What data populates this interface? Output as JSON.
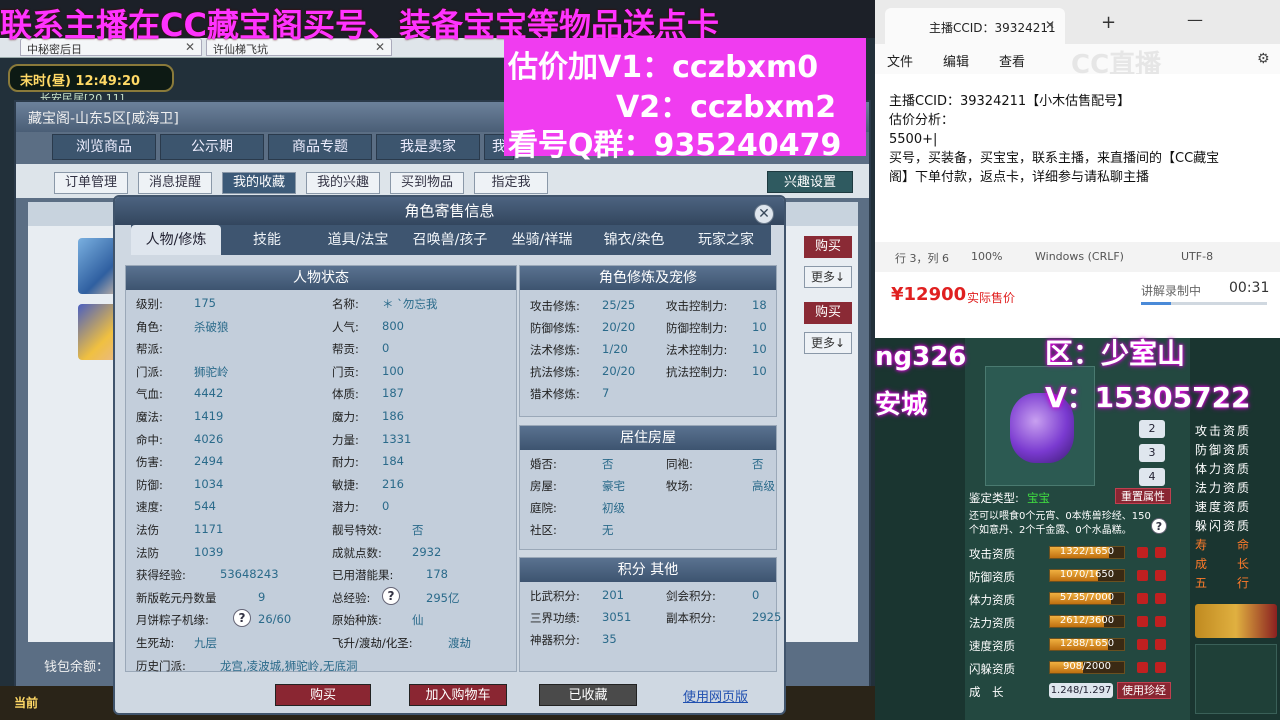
{
  "banner": {
    "top_text": "联系主播在CC藏宝阁买号、装备宝宝等物品送点卡",
    "price_line1": "估价加V1：cczbxm0",
    "price_line2": "V2：cczbxm2",
    "price_line3": "看号Q群：935240479"
  },
  "game": {
    "browser_tabs": [
      "中秘密后日",
      "许仙梯飞坑"
    ],
    "time": "末时(昼)  12:49:20",
    "location": "长安民居[20,11]",
    "window_title": "藏宝阁-山东5区[威海卫]",
    "main_tabs": [
      "浏览商品",
      "公示期",
      "商品专题",
      "我是卖家",
      "我"
    ],
    "sub_tabs": [
      "订单管理",
      "消息提醒",
      "我的收藏",
      "我的兴趣",
      "买到物品",
      "指定我"
    ],
    "interest_settings": "兴趣设置",
    "side_buy": "购买",
    "side_more": "更多↓",
    "wallet": "钱包余额：",
    "bottom_now": "当前"
  },
  "modal": {
    "title": "角色寄售信息",
    "tabs": [
      "人物/修炼",
      "技能",
      "道具/法宝",
      "召唤兽/孩子",
      "坐骑/祥瑞",
      "锦衣/染色",
      "玩家之家"
    ],
    "status_title": "人物状态",
    "left_col": [
      {
        "k": "级别:",
        "v": "175"
      },
      {
        "k": "角色:",
        "v": "杀破狼"
      },
      {
        "k": "帮派:",
        "v": ""
      },
      {
        "k": "门派:",
        "v": "狮驼岭"
      },
      {
        "k": "气血:",
        "v": "4442"
      },
      {
        "k": "魔法:",
        "v": "1419"
      },
      {
        "k": "命中:",
        "v": "4026"
      },
      {
        "k": "伤害:",
        "v": "2494"
      },
      {
        "k": "防御:",
        "v": "1034"
      },
      {
        "k": "速度:",
        "v": "544"
      },
      {
        "k": "法伤",
        "v": "1171"
      },
      {
        "k": "法防",
        "v": "1039"
      },
      {
        "k": "获得经验:",
        "v": "53648243"
      },
      {
        "k": "新版乾元丹数量",
        "v": "9"
      },
      {
        "k": "月饼粽子机缘:",
        "v": "26/60"
      },
      {
        "k": "生死劫:",
        "v": "九层"
      },
      {
        "k": "历史门派:",
        "v": "龙宫,凌波城,狮驼岭,无底洞"
      }
    ],
    "mid_col": [
      {
        "k": "名称:",
        "v": "＊ `勿忘我"
      },
      {
        "k": "人气:",
        "v": "800"
      },
      {
        "k": "帮贡:",
        "v": "0"
      },
      {
        "k": "门贡:",
        "v": "100"
      },
      {
        "k": "体质:",
        "v": "187"
      },
      {
        "k": "魔力:",
        "v": "186"
      },
      {
        "k": "力量:",
        "v": "1331"
      },
      {
        "k": "耐力:",
        "v": "184"
      },
      {
        "k": "敏捷:",
        "v": "216"
      },
      {
        "k": "潜力:",
        "v": "0"
      },
      {
        "k": "靓号特效:",
        "v": "否"
      },
      {
        "k": "成就点数:",
        "v": "2932"
      },
      {
        "k": "已用潜能果:",
        "v": "178"
      },
      {
        "k": "总经验:",
        "v": "295亿"
      },
      {
        "k": "原始种族:",
        "v": "仙"
      },
      {
        "k": "飞升/渡劫/化圣:",
        "v": "渡劫"
      }
    ],
    "train_title": "角色修炼及宠修",
    "train": [
      {
        "k": "攻击修炼:",
        "v": "25/25",
        "k2": "攻击控制力:",
        "v2": "18"
      },
      {
        "k": "防御修炼:",
        "v": "20/20",
        "k2": "防御控制力:",
        "v2": "10"
      },
      {
        "k": "法术修炼:",
        "v": "1/20",
        "k2": "法术控制力:",
        "v2": "10"
      },
      {
        "k": "抗法修炼:",
        "v": "20/20",
        "k2": "抗法控制力:",
        "v2": "10"
      },
      {
        "k": "猎术修炼:",
        "v": "7",
        "k2": "",
        "v2": ""
      }
    ],
    "house_title": "居住房屋",
    "house": [
      {
        "k": "婚否:",
        "v": "否",
        "k2": "同袍:",
        "v2": "否"
      },
      {
        "k": "房屋:",
        "v": "豪宅",
        "k2": "牧场:",
        "v2": "高级"
      },
      {
        "k": "庭院:",
        "v": "初级",
        "k2": "",
        "v2": ""
      },
      {
        "k": "社区:",
        "v": "无",
        "k2": "",
        "v2": ""
      }
    ],
    "points_title": "积分 其他",
    "points": [
      {
        "k": "比武积分:",
        "v": "201",
        "k2": "剑会积分:",
        "v2": "0"
      },
      {
        "k": "三界功绩:",
        "v": "3051",
        "k2": "副本积分:",
        "v2": "2925"
      },
      {
        "k": "神器积分:",
        "v": "35",
        "k2": "",
        "v2": ""
      }
    ],
    "btn_buy": "购买",
    "btn_cart": "加入购物车",
    "btn_collected": "已收藏",
    "link_web": "使用网页版"
  },
  "notepad": {
    "tab_title": "主播CCID：39324211",
    "menu": [
      "文件",
      "编辑",
      "查看"
    ],
    "content_lines": [
      "主播CCID：39324211【小木估售配号】",
      "估价分析：",
      "5500+|",
      "买号，买装备，买宝宝，联系主播，来直播间的【CC藏宝",
      "阁】下单付款，返点卡，详细参与请私聊主播"
    ],
    "status": [
      "行 3，列 6",
      "100%",
      "Windows (CRLF)",
      "UTF-8"
    ],
    "watermark": "CC直播"
  },
  "price_strip": {
    "price": "¥12900",
    "price_note": "实际售价",
    "recording": "讲解录制中",
    "timer": "00:31"
  },
  "pet": {
    "overlay_name": "ng326",
    "overlay_city": "安城",
    "overlay_region": "区：少室山",
    "overlay_v": "V：15305722",
    "appraise_label": "鉴定类型:",
    "appraise_value": "宝宝",
    "reset_btn": "重置属性",
    "hint": "还可以喂食0个元宵、0本炼兽珍经、150个如意丹、2个千金露、0个水晶糕。",
    "levels": [
      "2",
      "3",
      "4"
    ],
    "stats": [
      {
        "k": "攻击资质",
        "v": "1322/1650",
        "p": 0.8
      },
      {
        "k": "防御资质",
        "v": "1070/1650",
        "p": 0.65
      },
      {
        "k": "体力资质",
        "v": "5735/7000",
        "p": 0.82
      },
      {
        "k": "法力资质",
        "v": "2612/3600",
        "p": 0.73
      },
      {
        "k": "速度资质",
        "v": "1288/1650",
        "p": 0.78
      },
      {
        "k": "闪躲资质",
        "v": "908/2000",
        "p": 0.45
      }
    ],
    "growth_label": "成　长",
    "growth_value": "1.248/1.297",
    "use_pearl": "使用珍经",
    "side_attrs": [
      "攻击资质",
      "防御资质",
      "体力资质",
      "法力资质",
      "速度资质",
      "躲闪资质"
    ],
    "side_attrs2": [
      "寿　　命",
      "成　　长",
      "五　　行"
    ]
  }
}
